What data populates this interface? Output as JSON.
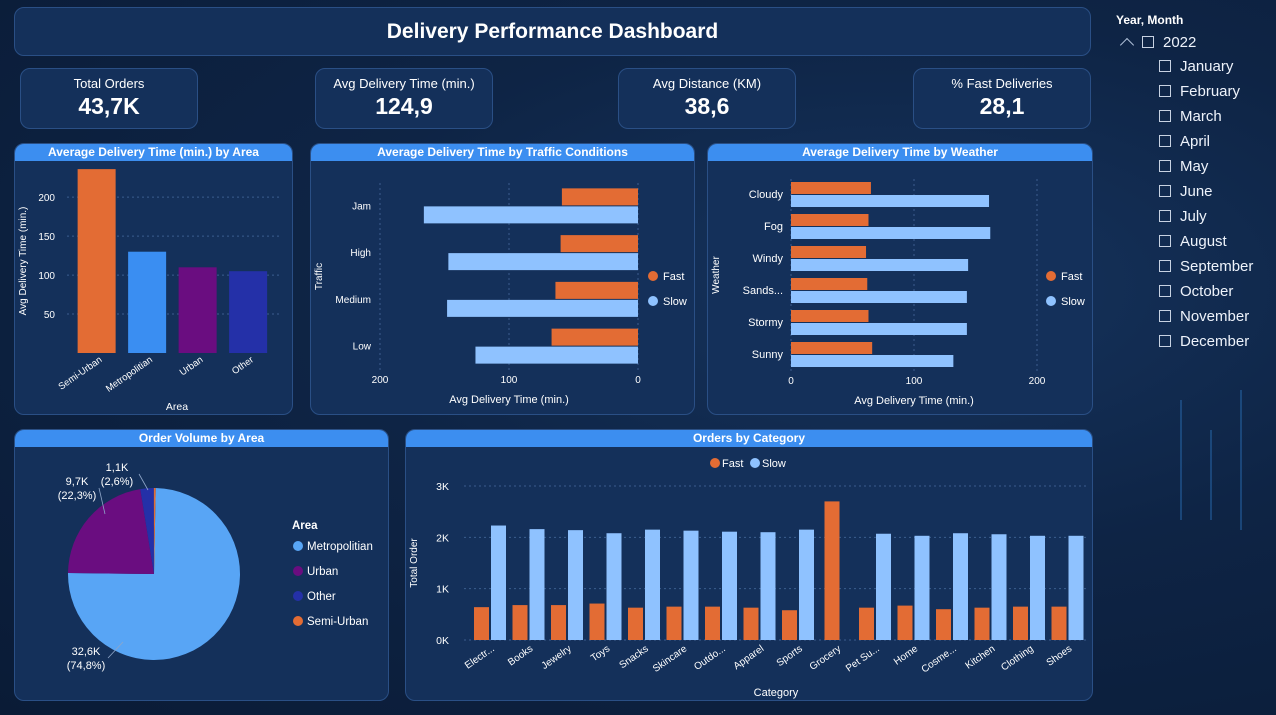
{
  "title": "Delivery Performance Dashboard",
  "kpis": [
    {
      "label": "Total Orders",
      "value": "43,7K"
    },
    {
      "label": "Avg Delivery Time (min.)",
      "value": "124,9"
    },
    {
      "label": "Avg Distance (KM)",
      "value": "38,6"
    },
    {
      "label": "% Fast Deliveries",
      "value": "28,1"
    }
  ],
  "slicer": {
    "header": "Year, Month",
    "year": "2022",
    "months": [
      "January",
      "February",
      "March",
      "April",
      "May",
      "June",
      "July",
      "August",
      "September",
      "October",
      "November",
      "December"
    ]
  },
  "colors": {
    "fast": "#e36c34",
    "slow": "#8fc2ff",
    "metropolitan": "#58a5f5",
    "urban": "#6a0d80",
    "other": "#2430a8",
    "semi_urban": "#e36c34",
    "panel": "#14305a",
    "header_bar": "#3c8ef0"
  },
  "chart_data": [
    {
      "id": "area",
      "type": "bar",
      "title": "Average Delivery Time (min.) by Area",
      "xlabel": "Area",
      "ylabel": "Avg Delivery Time (min.)",
      "categories": [
        "Semi-Urban",
        "Metropolitian",
        "Urban",
        "Other"
      ],
      "values": [
        236,
        130,
        110,
        105
      ],
      "colors": [
        "#e36c34",
        "#3a8ef2",
        "#6a0d80",
        "#2430a8"
      ],
      "yticks": [
        "50",
        "100",
        "150",
        "200"
      ],
      "ylim": [
        0,
        240
      ]
    },
    {
      "id": "traffic",
      "type": "bar",
      "orientation": "horizontal-reversed",
      "title": "Average Delivery Time by Traffic Conditions",
      "xlabel": "Avg Delivery Time (min.)",
      "ylabel": "Traffic",
      "categories": [
        "Jam",
        "High",
        "Medium",
        "Low"
      ],
      "series": [
        {
          "name": "Fast",
          "values": [
            59,
            60,
            64,
            67
          ]
        },
        {
          "name": "Slow",
          "values": [
            166,
            147,
            148,
            126
          ]
        }
      ],
      "xticks": [
        "200",
        "100",
        "0"
      ],
      "xlim": [
        0,
        200
      ]
    },
    {
      "id": "weather",
      "type": "bar",
      "orientation": "horizontal",
      "title": "Average Delivery Time by Weather",
      "xlabel": "Avg Delivery Time (min.)",
      "ylabel": "Weather",
      "categories": [
        "Cloudy",
        "Fog",
        "Windy",
        "Sands...",
        "Stormy",
        "Sunny"
      ],
      "series": [
        {
          "name": "Fast",
          "values": [
            65,
            63,
            61,
            62,
            63,
            66
          ]
        },
        {
          "name": "Slow",
          "values": [
            161,
            162,
            144,
            143,
            143,
            132
          ]
        }
      ],
      "xticks": [
        "0",
        "100",
        "200"
      ],
      "xlim": [
        0,
        200
      ]
    },
    {
      "id": "volume",
      "type": "pie",
      "title": "Order Volume by Area",
      "legend_title": "Area",
      "slices": [
        {
          "name": "Metropolitian",
          "value": 32.6,
          "label": "32,6K",
          "pct": "(74,8%)"
        },
        {
          "name": "Urban",
          "value": 9.7,
          "label": "9,7K",
          "pct": "(22,3%)"
        },
        {
          "name": "Other",
          "value": 1.1,
          "label": "1,1K",
          "pct": "(2,6%)"
        },
        {
          "name": "Semi-Urban",
          "value": 0.15,
          "label": "",
          "pct": ""
        }
      ]
    },
    {
      "id": "category",
      "type": "bar",
      "title": "Orders by Category",
      "xlabel": "Category",
      "ylabel": "Total Order",
      "categories": [
        "Electr...",
        "Books",
        "Jewelry",
        "Toys",
        "Snacks",
        "Skincare",
        "Outdo...",
        "Apparel",
        "Sports",
        "Grocery",
        "Pet Su...",
        "Home",
        "Cosme...",
        "Kitchen",
        "Clothing",
        "Shoes"
      ],
      "series": [
        {
          "name": "Fast",
          "values": [
            640,
            680,
            680,
            710,
            630,
            650,
            650,
            630,
            580,
            2700,
            630,
            670,
            600,
            630,
            650,
            650
          ]
        },
        {
          "name": "Slow",
          "values": [
            2230,
            2160,
            2140,
            2080,
            2150,
            2130,
            2110,
            2100,
            2150,
            0,
            2070,
            2030,
            2080,
            2060,
            2030,
            2030
          ]
        }
      ],
      "yticks": [
        "0K",
        "1K",
        "2K",
        "3K"
      ],
      "ylim": [
        0,
        3000
      ]
    }
  ]
}
